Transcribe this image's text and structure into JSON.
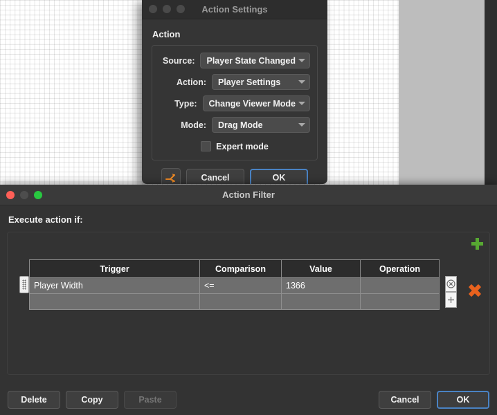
{
  "background": {
    "grid_color": "#e6e6e6",
    "panel_color": "#bdbdbd",
    "edge_color": "#2e2e2e"
  },
  "action_settings": {
    "title": "Action Settings",
    "window_controls": [
      "close",
      "minimize",
      "zoom"
    ],
    "section_title": "Action",
    "fields": [
      {
        "label": "Source:",
        "value": "Player State Changed"
      },
      {
        "label": "Action:",
        "value": "Player Settings"
      },
      {
        "label": "Type:",
        "value": "Change Viewer Mode"
      },
      {
        "label": "Mode:",
        "value": "Drag Mode"
      }
    ],
    "expert_mode": {
      "label": "Expert mode",
      "checked": false
    },
    "filter_icon": "action-filter-branch-icon",
    "filter_icon_color": "#f08a24",
    "cancel_label": "Cancel",
    "ok_label": "OK"
  },
  "action_filter": {
    "title": "Action Filter",
    "prompt": "Execute action if:",
    "add_icon": "plus-icon",
    "add_icon_color": "#57a832",
    "delete_icon": "x-icon",
    "delete_icon_color": "#e8621e",
    "columns": [
      "Trigger",
      "Comparison",
      "Value",
      "Operation"
    ],
    "rows": [
      {
        "trigger": "Player Width",
        "comparison": "<=",
        "value": "1366",
        "operation": ""
      },
      {
        "trigger": "",
        "comparison": "",
        "value": "",
        "operation": ""
      }
    ],
    "row_clear_icon": "circle-x-icon",
    "row_add_icon": "plus-icon",
    "drag_handle_icon": "drag-handle-icon",
    "footer": {
      "delete_label": "Delete",
      "copy_label": "Copy",
      "paste_label": "Paste",
      "paste_disabled": true,
      "cancel_label": "Cancel",
      "ok_label": "OK"
    }
  }
}
